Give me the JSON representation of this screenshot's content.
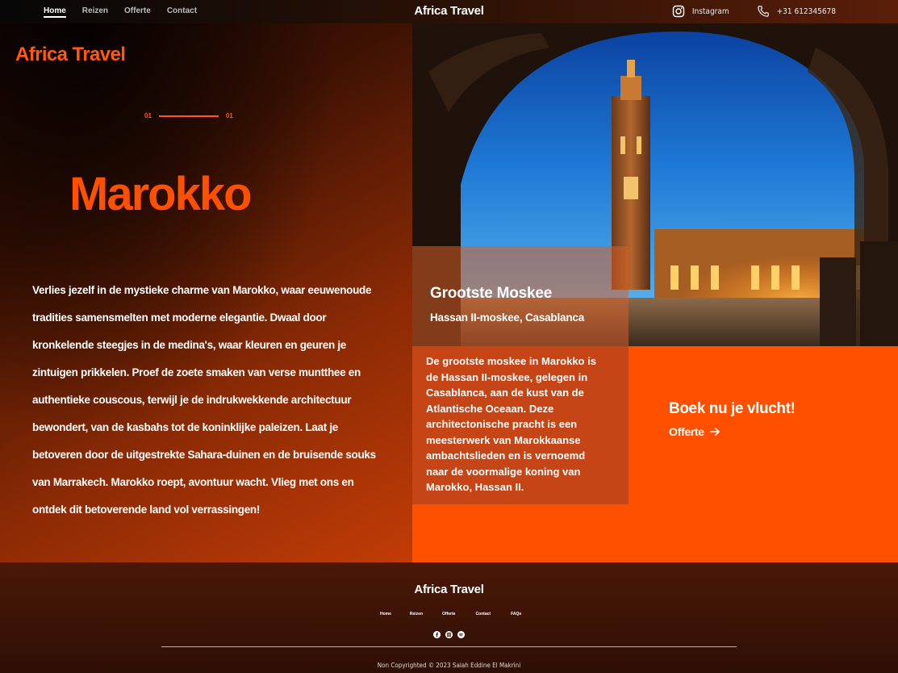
{
  "nav": {
    "links": [
      {
        "label": "Home",
        "active": true
      },
      {
        "label": "Reizen",
        "active": false
      },
      {
        "label": "Offerte",
        "active": false
      },
      {
        "label": "Contact",
        "active": false
      }
    ],
    "brand": "Africa Travel",
    "instagram": {
      "icon": "instagram-icon",
      "label": "Instagram"
    },
    "phone": {
      "icon": "phone-icon",
      "label": "+31 612345678"
    }
  },
  "hero": {
    "logo": "Africa Travel",
    "slide_current": "01",
    "slide_total": "01",
    "title": "Marokko",
    "text": "Verlies jezelf in de mystieke charme van Marokko, waar eeuwenoude tradities samensmelten met moderne elegantie. Dwaal door kronkelende steegjes in de medina's, waar kleuren en geuren je zintuigen prikkelen. Proef de zoete smaken van verse muntthee en authentieke couscous, terwijl je de indrukwekkende architectuur bewondert, van de kasbahs tot de koninklijke paleizen. Laat je betoveren door de uitgestrekte Sahara-duinen en de bruisende souks van Marrakech. Marokko roept, avontuur wacht. Vlieg met ons en ontdek dit betoverende land vol verrassingen!"
  },
  "feature": {
    "title": "Grootste Moskee",
    "subtitle": "Hassan II-moskee, Casablanca",
    "description": "De grootste moskee in Marokko is de Hassan II-moskee, gelegen in Casablanca, aan de kust van de Atlantische Oceaan. Deze architectonische pracht is een meesterwerk van Marokkaanse ambachtslieden en is vernoemd naar de voormalige koning van Marokko, Hassan II."
  },
  "cta": {
    "title": "Boek nu je vlucht!",
    "link_label": "Offerte",
    "link_icon": "arrow-right-icon"
  },
  "footer": {
    "brand": "Africa Travel",
    "links": [
      "Home",
      "Reizen",
      "Offerte",
      "Contact",
      "FAQs"
    ],
    "socials": [
      "facebook-icon",
      "instagram-icon",
      "spotify-icon"
    ],
    "copyright": "Non Copyrighted © 2023 Salah Eddine El Makrini"
  },
  "colors": {
    "accent": "#ff5000",
    "dark": "#2a0e04"
  }
}
